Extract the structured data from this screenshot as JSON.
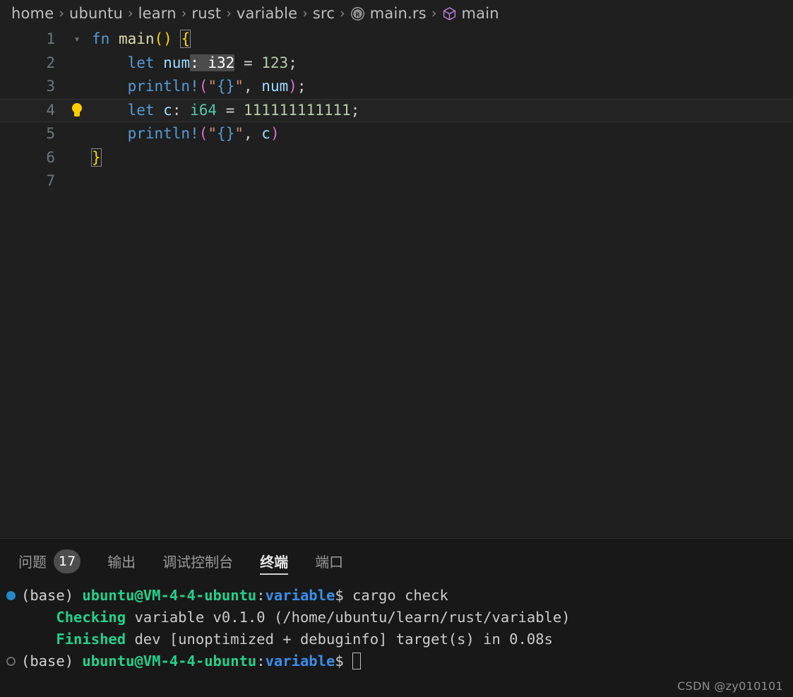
{
  "breadcrumb": {
    "items": [
      {
        "label": "home",
        "icon": null
      },
      {
        "label": "ubuntu",
        "icon": null
      },
      {
        "label": "learn",
        "icon": null
      },
      {
        "label": "rust",
        "icon": null
      },
      {
        "label": "variable",
        "icon": null
      },
      {
        "label": "src",
        "icon": null
      },
      {
        "label": "main.rs",
        "icon": "rust-file-icon"
      },
      {
        "label": "main",
        "icon": "symbol-function-cube-icon"
      }
    ],
    "separator": "›"
  },
  "editor": {
    "language": "rust",
    "active_line": 4,
    "lines": [
      {
        "num": "1",
        "fold": "chevron-down-icon",
        "bulb": false
      },
      {
        "num": "2",
        "fold": null,
        "bulb": false
      },
      {
        "num": "3",
        "fold": null,
        "bulb": false
      },
      {
        "num": "4",
        "fold": null,
        "bulb": true
      },
      {
        "num": "5",
        "fold": null,
        "bulb": false
      },
      {
        "num": "6",
        "fold": null,
        "bulb": false
      },
      {
        "num": "7",
        "fold": null,
        "bulb": false
      }
    ],
    "code": {
      "l1_fn": "fn",
      "l1_name": " main",
      "l1_parens": "()",
      "l1_space": " ",
      "l1_brace": "{",
      "l2_indent": "    ",
      "l2_let": "let",
      "l2_var": " num",
      "l2_sel": ": i32",
      "l2_eq": " = ",
      "l2_num": "123",
      "l2_semi": ";",
      "l3_indent": "    ",
      "l3_macro": "println!",
      "l3_lparen": "(",
      "l3_q1": "\"",
      "l3_brace": "{}",
      "l3_q2": "\"",
      "l3_comma": ", ",
      "l3_var": "num",
      "l3_rparen": ")",
      "l3_semi": ";",
      "l4_indent": "    ",
      "l4_let": "let",
      "l4_var": " c",
      "l4_colon": ": ",
      "l4_type": "i64",
      "l4_eq": " = ",
      "l4_num": "111111111111",
      "l4_semi": ";",
      "l5_indent": "    ",
      "l5_macro": "println!",
      "l5_lparen": "(",
      "l5_q1": "\"",
      "l5_brace": "{}",
      "l5_q2": "\"",
      "l5_comma": ", ",
      "l5_var": "c",
      "l5_rparen": ")",
      "l6_brace": "}",
      "l7_empty": ""
    }
  },
  "panel": {
    "tabs": [
      {
        "label": "问题",
        "badge": "17",
        "active": false
      },
      {
        "label": "输出",
        "badge": null,
        "active": false
      },
      {
        "label": "调试控制台",
        "badge": null,
        "active": false
      },
      {
        "label": "终端",
        "badge": null,
        "active": true
      },
      {
        "label": "端口",
        "badge": null,
        "active": false
      }
    ]
  },
  "terminal": {
    "lines": [
      {
        "marker": "filled",
        "prompt_env": "(base) ",
        "prompt_user": "ubuntu@VM-4-4-ubuntu",
        "prompt_colon": ":",
        "prompt_path": "variable",
        "prompt_dollar": "$ ",
        "command": "cargo check"
      },
      {
        "marker": null,
        "indent": "    ",
        "status": "Checking",
        "rest": " variable v0.1.0 (/home/ubuntu/learn/rust/variable)"
      },
      {
        "marker": null,
        "indent": "    ",
        "status": "Finished",
        "rest": " dev [unoptimized + debuginfo] target(s) in 0.08s"
      },
      {
        "marker": "hollow",
        "prompt_env": "(base) ",
        "prompt_user": "ubuntu@VM-4-4-ubuntu",
        "prompt_colon": ":",
        "prompt_path": "variable",
        "prompt_dollar": "$ ",
        "command": ""
      }
    ]
  },
  "watermark": {
    "text": "CSDN @zy010101"
  },
  "colors": {
    "editor_background": "#1f1f1f",
    "panel_background": "#181818",
    "current_line": "#232323",
    "selection": "#4b4b4b",
    "keyword": "#569cd6",
    "function": "#dcdcaa",
    "variable": "#9cdcfe",
    "type": "#4ec9b0",
    "number": "#b5cea8",
    "string": "#ce9178",
    "macro_paren": "#da70d6",
    "brace_yellow": "#ffd700",
    "terminal_green": "#23d18b",
    "terminal_blue": "#3b8eea",
    "marker_blue": "#2488c8",
    "badge_background": "#4d4d4d",
    "bulb_yellow": "#ffcc00"
  }
}
